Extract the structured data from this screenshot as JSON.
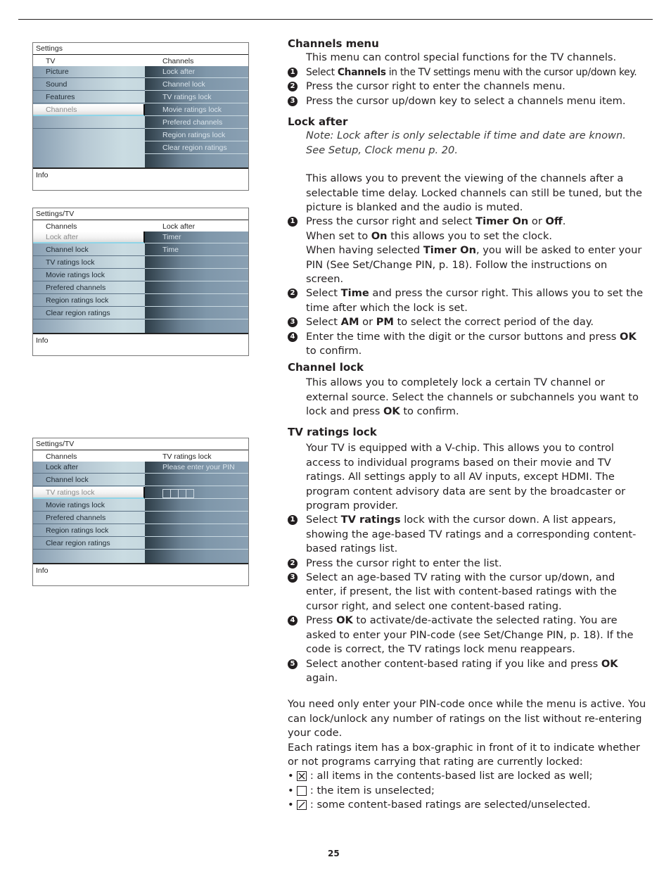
{
  "page_number": "25",
  "menus": [
    {
      "title": "Settings",
      "left_header": "TV",
      "right_header": "Channels",
      "left_items": [
        "Picture",
        "Sound",
        "Features",
        "Channels",
        "",
        "",
        "",
        ""
      ],
      "left_selected": 3,
      "right_items": [
        "Lock after",
        "Channel lock",
        "TV ratings lock",
        "Movie ratings lock",
        "Prefered channels",
        "Region ratings lock",
        "Clear region ratings",
        ""
      ],
      "info": "Info"
    },
    {
      "title": "Settings/TV",
      "left_header": "Channels",
      "right_header": "Lock after",
      "left_items": [
        "Lock after",
        "Channel lock",
        "TV ratings lock",
        "Movie ratings lock",
        "Prefered channels",
        "Region ratings lock",
        "Clear region ratings",
        ""
      ],
      "left_selected": 0,
      "right_items": [
        "Timer",
        "Time",
        "",
        "",
        "",
        "",
        "",
        ""
      ],
      "info": "Info"
    },
    {
      "title": "Settings/TV",
      "left_header": "Channels",
      "right_header": "TV ratings lock",
      "left_items": [
        "Lock after",
        "Channel lock",
        "TV ratings lock",
        "Movie ratings lock",
        "Prefered channels",
        "Region ratings lock",
        "Clear region ratings",
        ""
      ],
      "left_selected": 2,
      "right_items": [
        "Please enter your PIN",
        "",
        "[PIN]",
        "",
        "",
        "",
        "",
        ""
      ],
      "info": "Info"
    }
  ],
  "channels_menu": {
    "heading": "Channels menu",
    "intro": "This menu can control special functions for the TV channels.",
    "steps": [
      {
        "num": "1",
        "pre": "Select ",
        "bold": "Channels",
        "post": " in the TV settings menu with the cursor up/down key."
      },
      {
        "num": "2",
        "text": "Press the cursor right to enter the channels menu."
      },
      {
        "num": "3",
        "text": "Press the cursor up/down key to select a channels menu item."
      }
    ]
  },
  "lock_after": {
    "heading": "Lock after",
    "note": "Note: Lock after is only selectable if time and date are known. See Setup, Clock menu p. 20.",
    "desc": "This allows you to prevent the viewing of the channels after a selectable time delay. Locked channels can still be tuned, but the picture is blanked and the audio is muted.",
    "step1": {
      "num": "1",
      "a": "Press the cursor right and select ",
      "b1": "Timer On",
      "c": " or ",
      "b2": "Off",
      "d": ".",
      "line2a": "When set to ",
      "line2b": "On",
      "line2c": " this allows you to set the clock.",
      "line3a": "When having selected ",
      "line3b": "Timer On",
      "line3c": ", you will be asked to enter your PIN (See Set/Change PIN, p. 18). Follow the instructions on screen."
    },
    "step2": {
      "num": "2",
      "a": "Select ",
      "b": "Time",
      "c": " and press the cursor right. This allows you to set the time after which the lock is set."
    },
    "step3": {
      "num": "3",
      "a": "Select ",
      "b1": "AM",
      "c": " or ",
      "b2": "PM",
      "d": " to select the correct period of the day."
    },
    "step4": {
      "num": "4",
      "a": "Enter the time with the digit or the cursor buttons and press ",
      "b": "OK",
      "c": " to confirm."
    }
  },
  "channel_lock": {
    "heading": "Channel lock",
    "a": "This allows you to completely lock a certain TV channel or external source. Select the channels or subchannels you want to lock and press ",
    "b": "OK",
    "c": " to confirm."
  },
  "tv_ratings_lock": {
    "heading": "TV ratings lock",
    "intro": "Your TV is equipped with a V-chip. This allows you to control access to individual programs based on their movie and TV ratings. All settings apply to all AV inputs, except HDMI. The program content advisory data are sent by the broadcaster or program provider.",
    "step1": {
      "num": "1",
      "a": "Select ",
      "b": "TV ratings",
      "c": " lock with the cursor down. A list appears, showing the age-based TV ratings and a corresponding content-based ratings list."
    },
    "step2": {
      "num": "2",
      "text": "Press the cursor right to enter the list."
    },
    "step3": {
      "num": "3",
      "text": "Select an age-based TV rating with the cursor up/down, and enter, if present, the list with content-based ratings with the cursor right, and select one content-based rating."
    },
    "step4": {
      "num": "4",
      "a": "Press ",
      "b": "OK",
      "c": " to activate/de-activate the selected rating. You are asked to enter your PIN-code (see Set/Change PIN, p. 18). If the code is correct, the TV ratings lock menu reappears."
    },
    "step5": {
      "num": "5",
      "a": "Select another content-based rating if you like and press ",
      "b": "OK",
      "c": " again."
    },
    "para1": "You need only enter your PIN-code once while the menu is active. You can lock/unlock any number of ratings on the list without re-entering your code.",
    "para2": "Each ratings item has a box-graphic in front of it to indicate whether or not programs carrying that rating are currently locked:",
    "bullets": [
      {
        "icon": "box-crossed-icon",
        "text": " : all items in the contents-based list are locked as well;"
      },
      {
        "icon": "box-empty-icon",
        "text": " : the item is unselected;"
      },
      {
        "icon": "box-slashed-icon",
        "text": " : some content-based ratings are selected/unselected."
      }
    ]
  }
}
